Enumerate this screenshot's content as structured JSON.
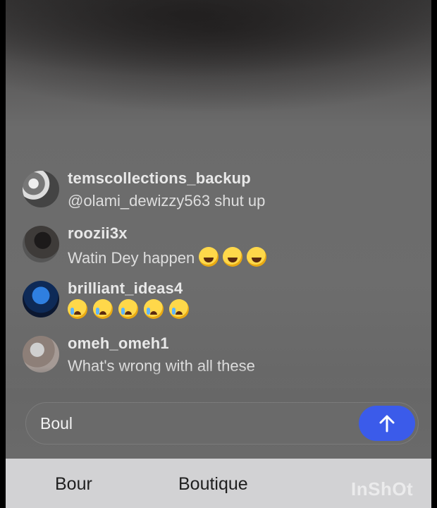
{
  "comments": [
    {
      "username": "temscollections_backup",
      "text": "@olami_dewizzy563 shut up",
      "emojis": [],
      "avatar": "avatar-photo"
    },
    {
      "username": "roozii3x",
      "text": "Watin Dey happen",
      "emojis": [
        "laughing-tears-icon",
        "laughing-tears-icon",
        "laughing-tears-icon"
      ],
      "avatar": "avatar-photo"
    },
    {
      "username": "brilliant_ideas4",
      "text": "",
      "emojis": [
        "crying-face-icon",
        "crying-face-icon",
        "crying-face-icon",
        "crying-face-icon",
        "crying-face-icon"
      ],
      "avatar": "avatar-photo"
    },
    {
      "username": "omeh_omeh1",
      "text": "What's wrong with all these",
      "emojis": [],
      "avatar": "avatar-photo"
    }
  ],
  "input": {
    "value": "Boul",
    "send_icon": "arrow-up-icon"
  },
  "suggestions": [
    "Bour",
    "Boutique"
  ],
  "watermark": "InShOt",
  "colors": {
    "send_button": "#3b5bea",
    "suggestion_bar": "#d2d2d4"
  }
}
